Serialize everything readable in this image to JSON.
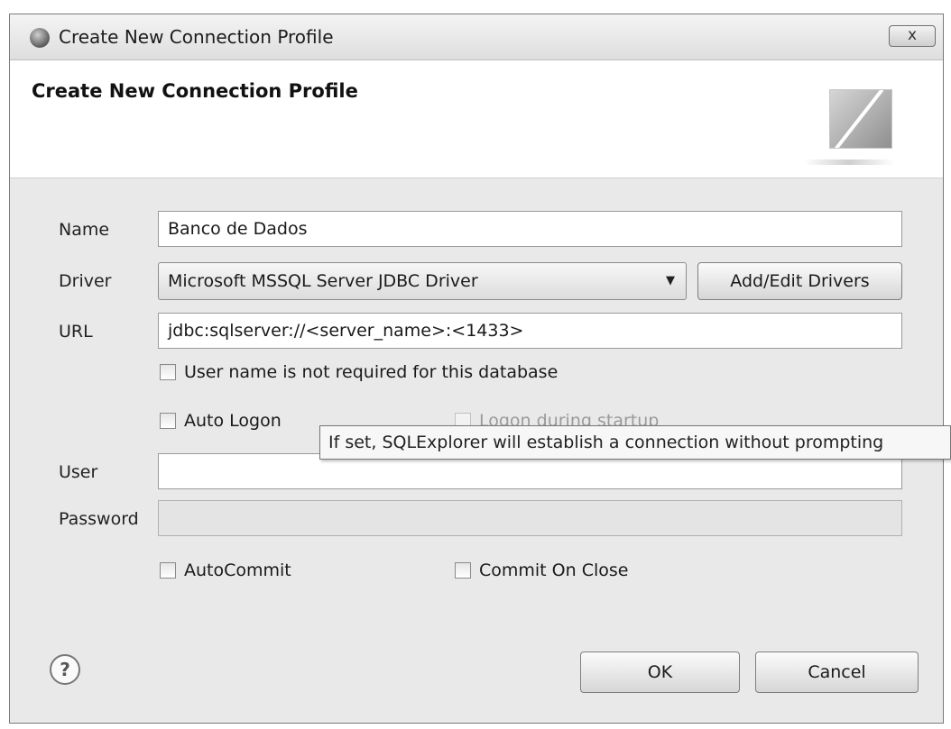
{
  "window": {
    "title": "Create New Connection Profile",
    "close_label": "x"
  },
  "banner": {
    "title": "Create New Connection Profile"
  },
  "form": {
    "name_label": "Name",
    "name_value": "Banco de Dados",
    "driver_label": "Driver",
    "driver_value": "Microsoft MSSQL Server JDBC Driver",
    "add_edit_drivers_label": "Add/Edit Drivers",
    "url_label": "URL",
    "url_value": "jdbc:sqlserver://<server_name>:<1433>",
    "user_not_required_label": "User name is not required for this database",
    "auto_logon_label": "Auto Logon",
    "logon_startup_label": "Logon during startup",
    "tooltip_text": "If set, SQLExplorer will establish a connection without prompting",
    "user_label": "User",
    "user_value": "",
    "password_label": "Password",
    "password_value": "",
    "autocommit_label": "AutoCommit",
    "commit_on_close_label": "Commit On Close"
  },
  "footer": {
    "help_label": "?",
    "ok_label": "OK",
    "cancel_label": "Cancel"
  }
}
